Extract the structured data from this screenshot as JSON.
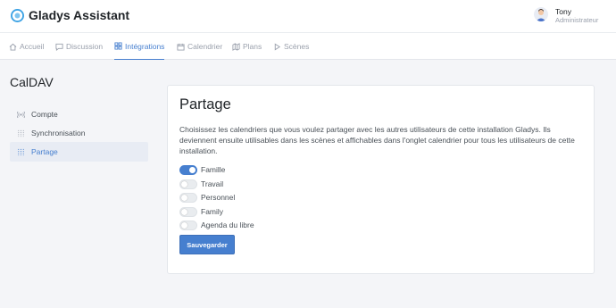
{
  "app": {
    "brand": "Gladys Assistant"
  },
  "user": {
    "name": "Tony",
    "role": "Administrateur"
  },
  "nav": {
    "items": [
      {
        "label": "Accueil",
        "icon": "home-icon",
        "active": false
      },
      {
        "label": "Discussion",
        "icon": "message-square-icon",
        "active": false
      },
      {
        "label": "Intégrations",
        "icon": "grid-icon",
        "active": true
      },
      {
        "label": "Calendrier",
        "icon": "calendar-icon",
        "active": false
      },
      {
        "label": "Plans",
        "icon": "map-icon",
        "active": false
      },
      {
        "label": "Scènes",
        "icon": "play-icon",
        "active": false
      }
    ]
  },
  "sidebar": {
    "title": "CalDAV",
    "items": [
      {
        "label": "Compte",
        "icon": "radio-icon",
        "active": false
      },
      {
        "label": "Synchronisation",
        "icon": "sliders-icon",
        "active": false
      },
      {
        "label": "Partage",
        "icon": "sliders-icon",
        "active": true
      }
    ]
  },
  "card": {
    "title": "Partage",
    "description": "Choisissez les calendriers que vous voulez partager avec les autres utilisateurs de cette installation Gladys. Ils deviennent ensuite utilisables dans les scènes et affichables dans l'onglet calendrier pour tous les utilisateurs de cette installation.",
    "calendars": [
      {
        "label": "Famille",
        "enabled": true
      },
      {
        "label": "Travail",
        "enabled": false
      },
      {
        "label": "Personnel",
        "enabled": false
      },
      {
        "label": "Family",
        "enabled": false
      },
      {
        "label": "Agenda du libre",
        "enabled": false
      }
    ],
    "save_label": "Sauvegarder"
  },
  "colors": {
    "accent": "#467fcf",
    "background": "#f4f5f8"
  }
}
